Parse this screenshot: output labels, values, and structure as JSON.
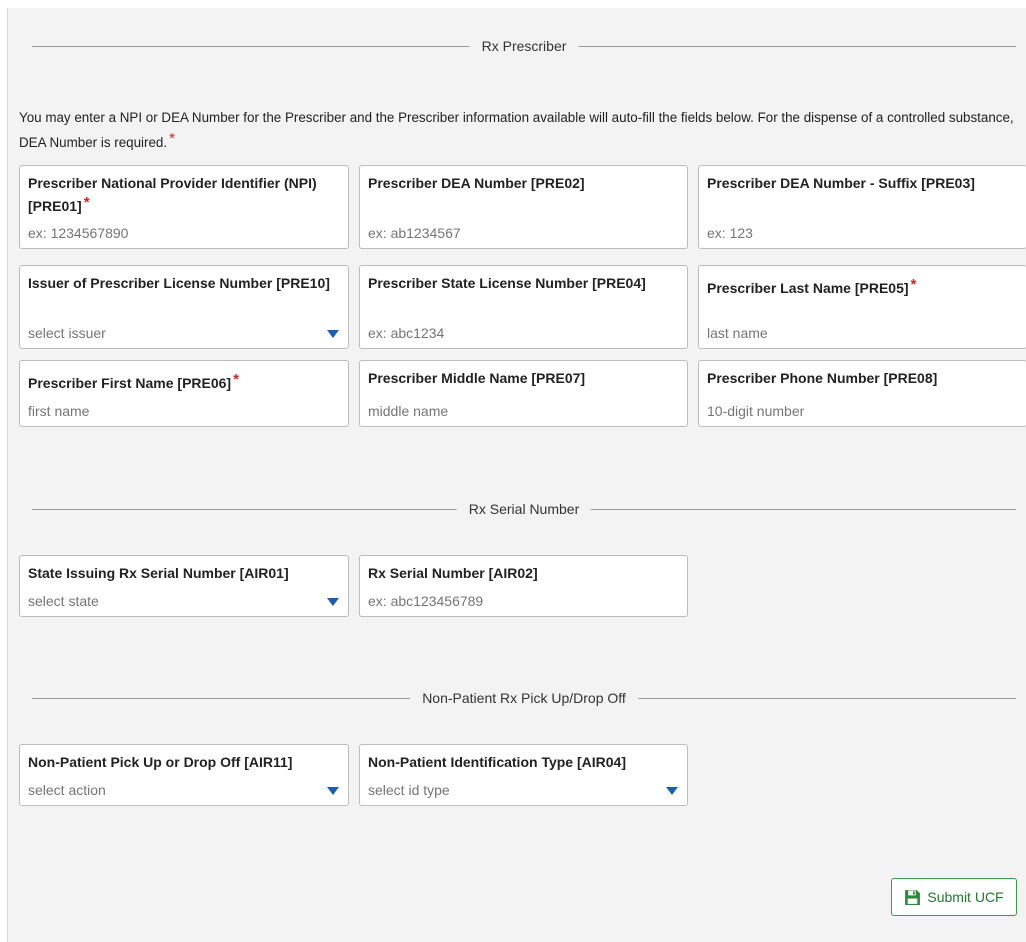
{
  "sections": {
    "prescriber": "Rx Prescriber",
    "serial": "Rx Serial Number",
    "nonpatient": "Non-Patient Rx Pick Up/Drop Off"
  },
  "intro_text": "You may enter a NPI or DEA Number for the Prescriber and the Prescriber information available will auto-fill the fields below. For the dispense of a controlled substance, DEA Number is required.",
  "required_mark": "*",
  "fields": {
    "npi": {
      "label": "Prescriber National Provider Identifier (NPI) [PRE01]",
      "placeholder": "ex: 1234567890"
    },
    "dea": {
      "label": "Prescriber DEA Number [PRE02]",
      "placeholder": "ex: ab1234567"
    },
    "dea_suffix": {
      "label": "Prescriber DEA Number - Suffix [PRE03]",
      "placeholder": "ex: 123"
    },
    "license_issuer": {
      "label": "Issuer of Prescriber License Number [PRE10]",
      "value": "select issuer"
    },
    "state_license": {
      "label": "Prescriber State License Number [PRE04]",
      "placeholder": "ex: abc1234"
    },
    "last_name": {
      "label": "Prescriber Last Name [PRE05]",
      "placeholder": "last name"
    },
    "first_name": {
      "label": "Prescriber First Name [PRE06]",
      "placeholder": "first name"
    },
    "middle_name": {
      "label": "Prescriber Middle Name [PRE07]",
      "placeholder": "middle name"
    },
    "phone": {
      "label": "Prescriber Phone Number [PRE08]",
      "placeholder": "10-digit number"
    },
    "serial_state": {
      "label": "State Issuing Rx Serial Number [AIR01]",
      "value": "select state"
    },
    "serial_number": {
      "label": "Rx Serial Number [AIR02]",
      "placeholder": "ex: abc123456789"
    },
    "pickup_dropoff": {
      "label": "Non-Patient Pick Up or Drop Off [AIR11]",
      "value": "select action"
    },
    "id_type": {
      "label": "Non-Patient Identification Type [AIR04]",
      "value": "select id type"
    }
  },
  "submit_label": "Submit UCF",
  "colors": {
    "required": "#e02020",
    "caret": "#1a5fb4",
    "submit": "#1f7a2f"
  },
  "icons": {
    "submit": "save-icon",
    "dropdown": "caret-down-icon"
  }
}
